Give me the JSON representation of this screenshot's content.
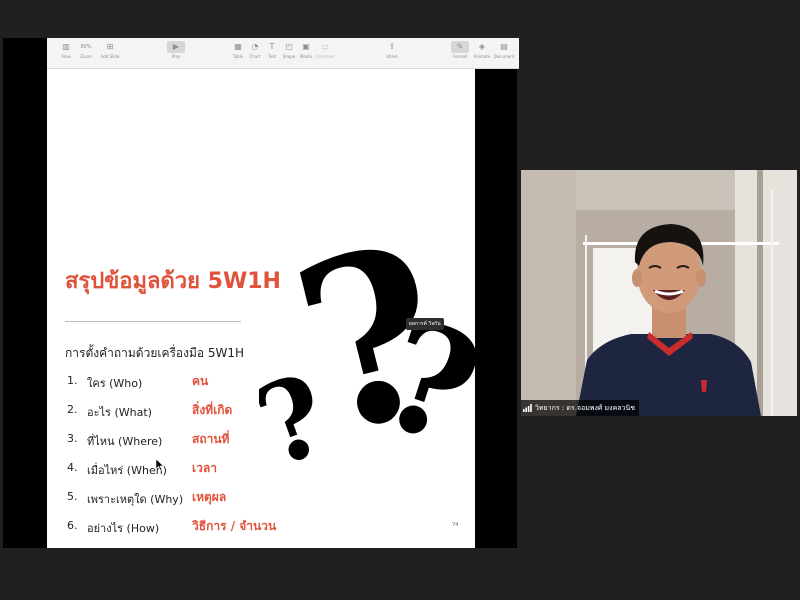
{
  "toolbar": {
    "items": [
      {
        "label": "View",
        "icon": "sidebar-icon"
      },
      {
        "label": "Zoom",
        "icon": "zoom-icon",
        "value": "80%"
      },
      {
        "label": "Add Slide",
        "icon": "add-slide-icon"
      },
      {
        "label": "Play",
        "icon": "play-icon"
      },
      {
        "label": "Table",
        "icon": "table-icon"
      },
      {
        "label": "Chart",
        "icon": "chart-icon"
      },
      {
        "label": "Text",
        "icon": "text-icon"
      },
      {
        "label": "Shape",
        "icon": "shape-icon"
      },
      {
        "label": "Media",
        "icon": "media-icon"
      },
      {
        "label": "Comment",
        "icon": "comment-icon"
      },
      {
        "label": "Share",
        "icon": "share-icon"
      },
      {
        "label": "Format",
        "icon": "format-brush-icon"
      },
      {
        "label": "Animate",
        "icon": "animate-icon"
      },
      {
        "label": "Document",
        "icon": "document-icon"
      }
    ]
  },
  "slide": {
    "title": "สรุปข้อมูลด้วย 5W1H",
    "subtitle": "การตั้งคำถามด้วยเครื่องมือ 5W1H",
    "items": [
      {
        "num": "1.",
        "question": "ใคร (Who)",
        "answer": "คน"
      },
      {
        "num": "2.",
        "question": "อะไร (What)",
        "answer": "สิ่งที่เกิด"
      },
      {
        "num": "3.",
        "question": "ที่ไหน (Where)",
        "answer": "สถานที่"
      },
      {
        "num": "4.",
        "question": "เมื่อไหร่ (When)",
        "answer": "เวลา"
      },
      {
        "num": "5.",
        "question": "เพราะเหตุใด (Why)",
        "answer": "เหตุผล"
      },
      {
        "num": "6.",
        "question": "อย่างไร (How)",
        "answer": "วิธีการ / จำนวน"
      }
    ],
    "popup_text": "ผลการค์ วิจกัน",
    "page_number": "74"
  },
  "participant": {
    "name": "วิทยากร : ดร.จอมพงศ์ มงคลวนิช",
    "signal_icon": "signal-bars-icon"
  },
  "colors": {
    "accent": "#e0533b",
    "background": "#202020"
  }
}
